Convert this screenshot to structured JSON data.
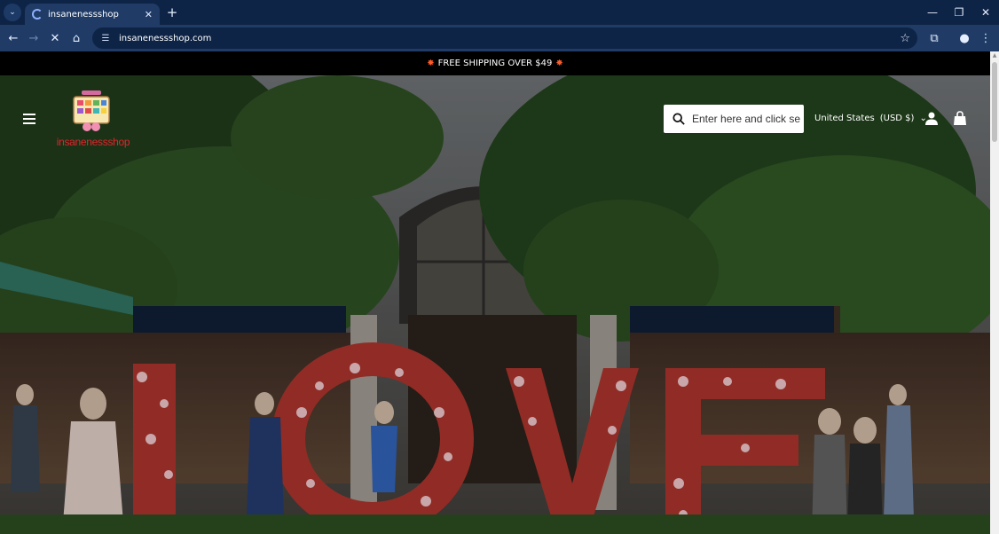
{
  "browser": {
    "tab_title": "insanenessshop",
    "url": "insanenessshop.com"
  },
  "icons": {
    "tab_menu": "chevron-down-icon",
    "favicon": "loading-spinner-icon",
    "tab_close": "close-icon",
    "new_tab": "plus-icon",
    "minimize": "minimize-icon",
    "restore": "restore-icon",
    "close_window": "close-icon",
    "back": "arrow-left-icon",
    "forward": "arrow-right-icon",
    "stop": "stop-icon",
    "home": "home-icon",
    "site_info": "tune-icon",
    "bookmark": "star-icon",
    "extensions": "puzzle-icon",
    "profile": "person-icon",
    "menu": "kebab-icon",
    "hamburger": "hamburger-icon",
    "search": "search-icon",
    "account": "account-icon",
    "cart": "shopping-bag-icon"
  },
  "announcement": {
    "text": "FREE SHIPPING OVER $49"
  },
  "header": {
    "logo_text": "insanenessshop",
    "search_placeholder": "Enter here and click sear",
    "currency": "United States",
    "currency_code": "(USD $)"
  },
  "colors": {
    "chrome_dark": "#0e2446",
    "chrome_toolbar": "#1f3b66",
    "announce_bg": "#000000",
    "logo_red": "#e0252d"
  }
}
